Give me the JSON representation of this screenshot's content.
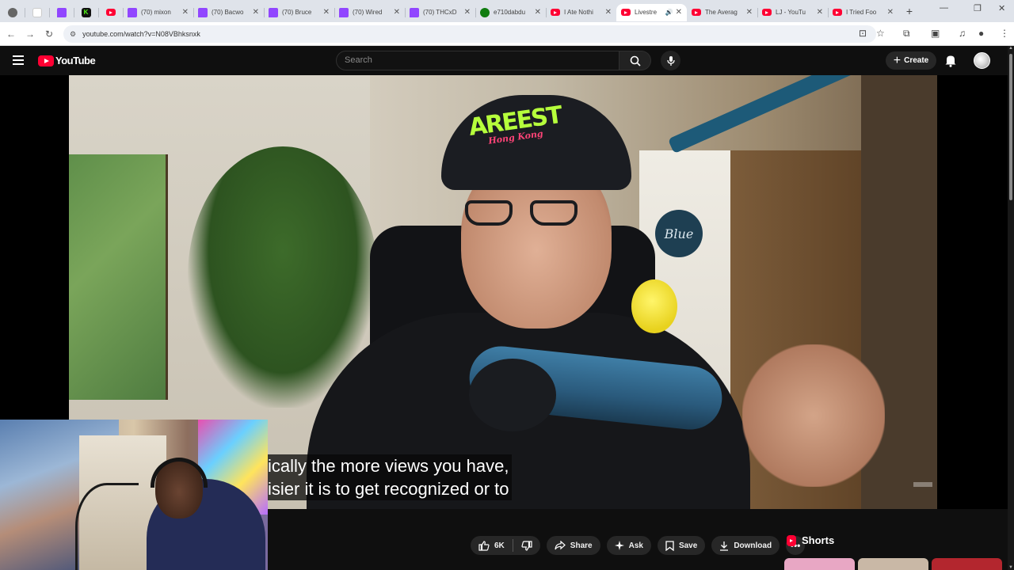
{
  "browser": {
    "tabs": [
      {
        "title": "",
        "icon": "chrome-settings-icon",
        "fav": "gray"
      },
      {
        "title": "",
        "icon": "blank-page-icon",
        "fav": "blank"
      },
      {
        "title": "",
        "icon": "twitch-icon",
        "fav": "tw"
      },
      {
        "title": "",
        "icon": "kick-icon",
        "fav": "kick"
      },
      {
        "title": "",
        "icon": "youtube-icon",
        "fav": "yt"
      },
      {
        "title": "(70) mixon",
        "icon": "twitch-icon",
        "fav": "tw"
      },
      {
        "title": "(70) Bacwo",
        "icon": "twitch-icon",
        "fav": "tw"
      },
      {
        "title": "(70) Bruce",
        "icon": "twitch-icon",
        "fav": "tw"
      },
      {
        "title": "(70) Wired",
        "icon": "twitch-icon",
        "fav": "tw"
      },
      {
        "title": "(70) THCxD",
        "icon": "twitch-icon",
        "fav": "tw"
      },
      {
        "title": "e710dabdu",
        "icon": "xbox-icon",
        "fav": "xbox"
      },
      {
        "title": "I Ate Nothi",
        "icon": "youtube-icon",
        "fav": "yt"
      },
      {
        "title": "Livestre",
        "icon": "youtube-icon",
        "fav": "yt",
        "active": true
      },
      {
        "title": "The Averag",
        "icon": "youtube-icon",
        "fav": "yt"
      },
      {
        "title": "LJ - YouTu",
        "icon": "youtube-icon",
        "fav": "yt"
      },
      {
        "title": "I Tried Foo",
        "icon": "youtube-icon",
        "fav": "yt"
      }
    ],
    "url": "youtube.com/watch?v=N08VBhksnxk"
  },
  "youtube": {
    "logo_text": "YouTube",
    "search_placeholder": "Search",
    "create_label": "Create"
  },
  "video": {
    "cap_text": "AREEST",
    "cap_subtext": "Hong Kong",
    "mic_brand": "Blue",
    "captions": [
      "ically the more views you have,",
      "isier it is to get recognized or to"
    ]
  },
  "actions": {
    "like_count": "6K",
    "share_label": "Share",
    "ask_label": "Ask",
    "save_label": "Save",
    "download_label": "Download"
  },
  "sidebar": {
    "shorts_label": "Shorts",
    "thumb_colors": [
      "#e8a7c4",
      "#c9b8a6",
      "#b3262e"
    ]
  },
  "colors": {
    "brand_red": "#ff0033",
    "background": "#0f0f0f",
    "pill": "#272727"
  }
}
